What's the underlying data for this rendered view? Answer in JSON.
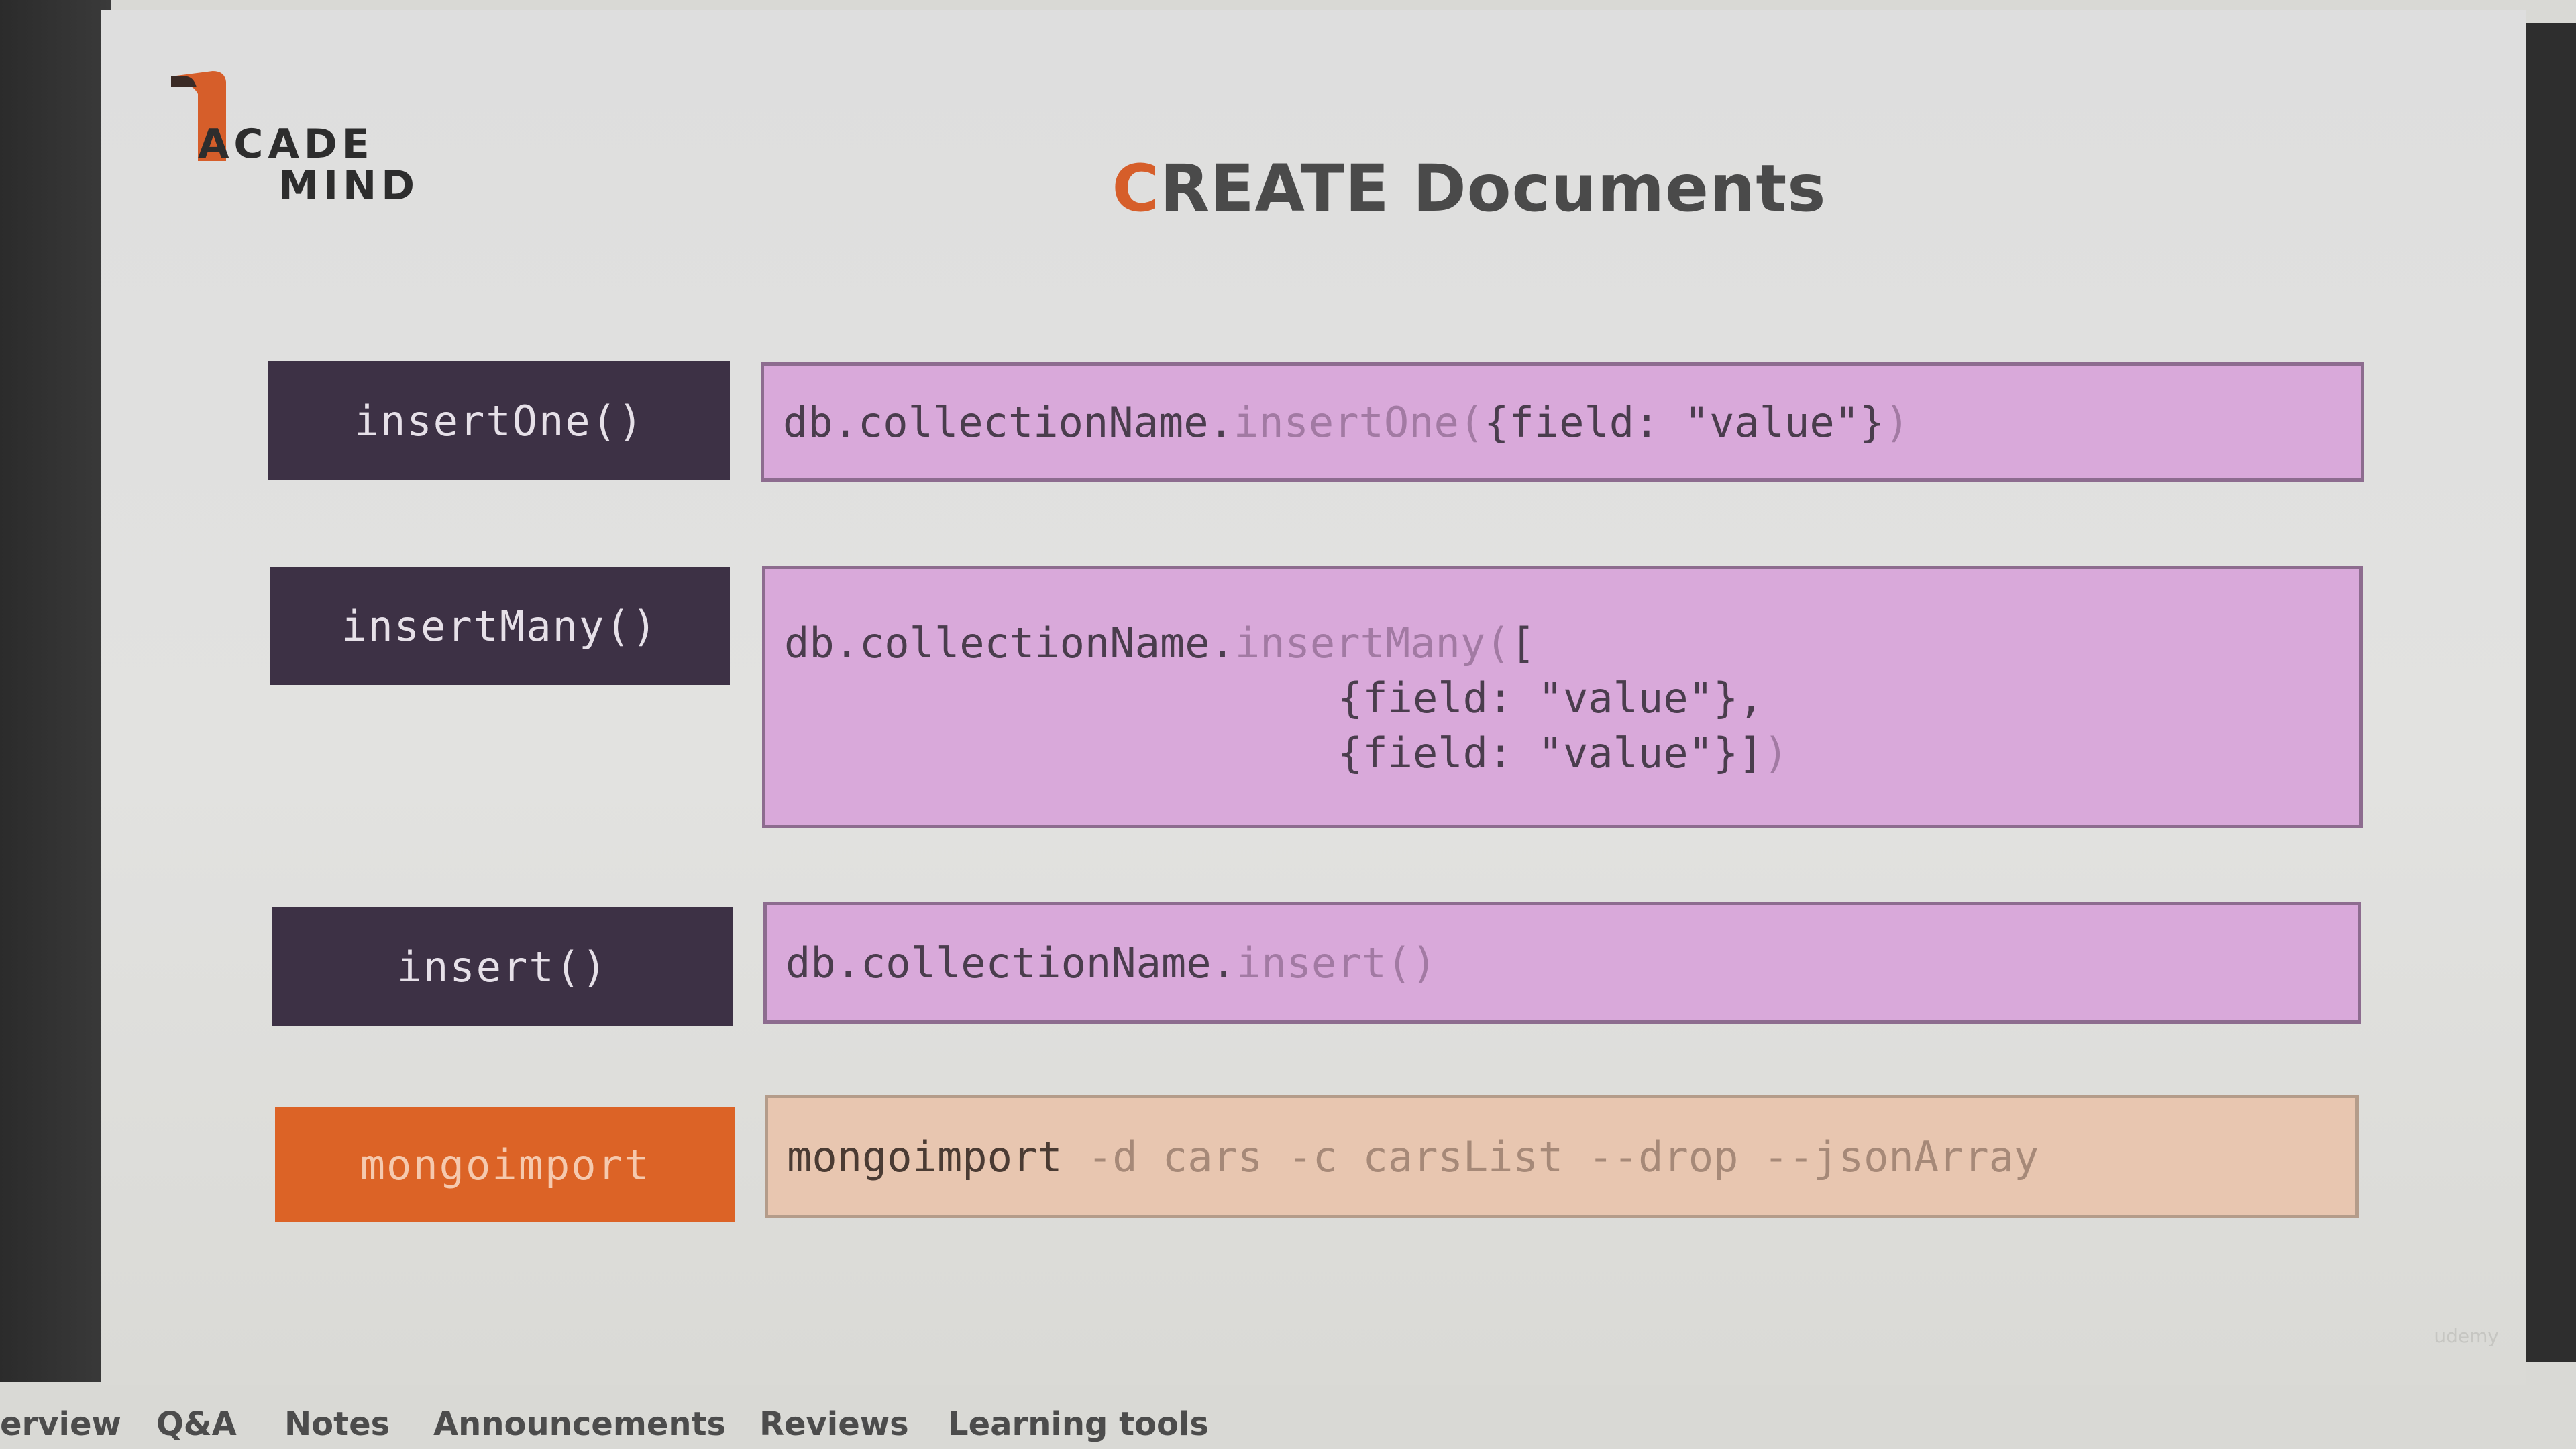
{
  "logo": {
    "line1": "ACADE",
    "line2": "MIND",
    "color": "#d65e2a"
  },
  "title": {
    "accent": "C",
    "rest": "REATE Documents"
  },
  "rows": [
    {
      "label": "insertOne()",
      "code_prefix": "db.collectionName.",
      "code_method": "insertOne(",
      "code_args": "{field: \"value\"}",
      "code_suffix": ")"
    },
    {
      "label": "insertMany()",
      "code_prefix": "db.collectionName.",
      "code_method": "insertMany(",
      "code_args": "[",
      "line2": "{field: \"value\"},",
      "line3": "{field: \"value\"}]",
      "line3_suffix": ")"
    },
    {
      "label": "insert()",
      "code_prefix": "db.collectionName.",
      "code_method": "insert()"
    },
    {
      "label": "mongoimport",
      "code_prefix": "mongoimport ",
      "code_rest": "-d cars -c carsList --drop --jsonArray"
    }
  ],
  "colors": {
    "dark_label": "#3d3145",
    "orange_label": "#dc6326",
    "code_bg": "#d9a9da",
    "import_bg": "#e8c6b0"
  },
  "watermark": "udemy",
  "tabs": [
    "erview",
    "Q&A",
    "Notes",
    "Announcements",
    "Reviews",
    "Learning tools"
  ]
}
